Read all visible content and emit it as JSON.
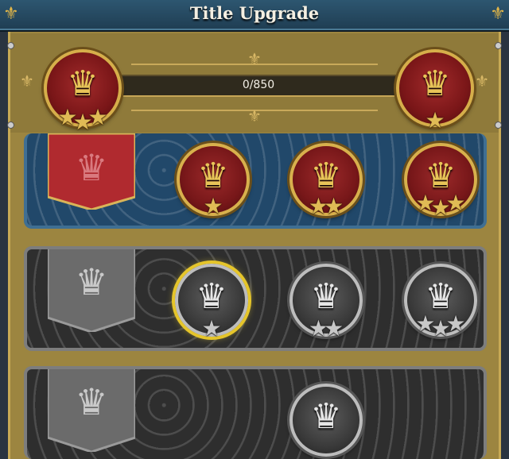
{
  "header": {
    "title": "Title Upgrade",
    "progress_text": "0/850",
    "progress_fraction": 0.0
  },
  "icons": {
    "crown": "♛",
    "star": "★",
    "fleur": "⚜"
  },
  "colors": {
    "gold": "#d8b04c",
    "red_medal": "#7a1618",
    "blue_row": "#21486a",
    "silver": "#bdbdbd",
    "selected_glow": "#e5c52a"
  },
  "current_title": {
    "stars": 3
  },
  "next_title": {
    "stars": 1
  },
  "tiers": [
    {
      "name": "red",
      "levels": [
        {
          "stars": 1
        },
        {
          "stars": 2
        },
        {
          "stars": 3
        }
      ]
    },
    {
      "name": "silver",
      "levels": [
        {
          "stars": 1,
          "selected": true
        },
        {
          "stars": 2
        },
        {
          "stars": 3
        }
      ]
    },
    {
      "name": "silver-top",
      "levels": [
        {
          "stars": 0
        }
      ]
    }
  ]
}
